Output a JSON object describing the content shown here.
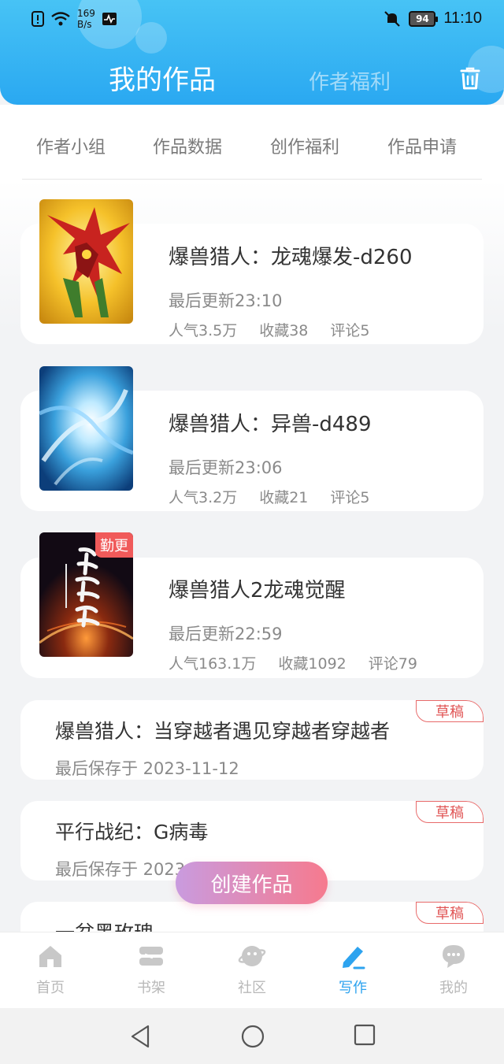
{
  "status_bar": {
    "speed": "169\nB/s",
    "speed_value": "169",
    "speed_unit": "B/s",
    "battery": "94",
    "time": "11:10"
  },
  "header": {
    "tab_active": "我的作品",
    "tab_inactive": "作者福利",
    "trash_icon": "trash-icon"
  },
  "quick_nav": [
    "作者小组",
    "作品数据",
    "创作福利",
    "作品申请"
  ],
  "works": [
    {
      "title": "爆兽猎人：龙魂爆发-d260",
      "updated": "最后更新23:10",
      "popularity": "人气3.5万",
      "favorites": "收藏38",
      "comments": "评论5",
      "badge": ""
    },
    {
      "title": "爆兽猎人：异兽-d489",
      "updated": "最后更新23:06",
      "popularity": "人气3.2万",
      "favorites": "收藏21",
      "comments": "评论5",
      "badge": ""
    },
    {
      "title": "爆兽猎人2龙魂觉醒",
      "updated": "最后更新22:59",
      "popularity": "人气163.1万",
      "favorites": "收藏1092",
      "comments": "评论79",
      "badge": "勤更"
    }
  ],
  "drafts": [
    {
      "title": "爆兽猎人：当穿越者遇见穿越者穿越者",
      "saved": "最后保存于 2023-11-12",
      "tag": "草稿"
    },
    {
      "title": "平行战纪：G病毒",
      "saved": "最后保存于 2023-00-00",
      "tag": "草稿"
    },
    {
      "title": "一盆黑玫瑰",
      "saved": "",
      "tag": "草稿"
    }
  ],
  "create_button": "创建作品",
  "tabbar": [
    {
      "label": "首页",
      "icon": "home-icon"
    },
    {
      "label": "书架",
      "icon": "bookshelf-icon"
    },
    {
      "label": "社区",
      "icon": "community-icon"
    },
    {
      "label": "写作",
      "icon": "write-icon"
    },
    {
      "label": "我的",
      "icon": "profile-icon"
    }
  ],
  "colors": {
    "header": "#2aa8f1",
    "accent": "#2da3ef",
    "draft_tag": "#e05555",
    "create_start": "#c99bdf",
    "create_end": "#f67a8e"
  }
}
